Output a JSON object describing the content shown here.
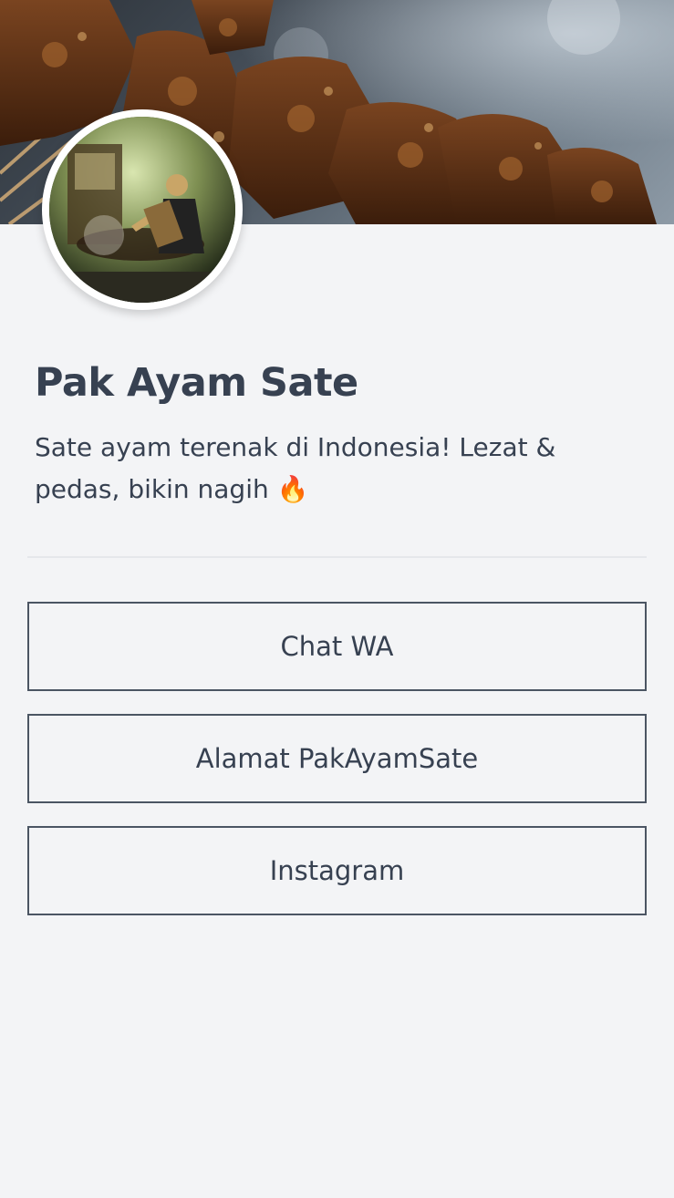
{
  "profile": {
    "name": "Pak Ayam Sate",
    "bio_text": "Sate ayam terenak di Indonesia! Lezat & pedas, bikin nagih",
    "bio_emoji": "🔥"
  },
  "links": [
    {
      "label": "Chat WA"
    },
    {
      "label": "Alamat PakAyamSate"
    },
    {
      "label": "Instagram"
    }
  ],
  "images": {
    "cover": "photo-grilled-chicken-satay-skewers",
    "avatar": "photo-satay-vendor-grilling-at-stall"
  }
}
